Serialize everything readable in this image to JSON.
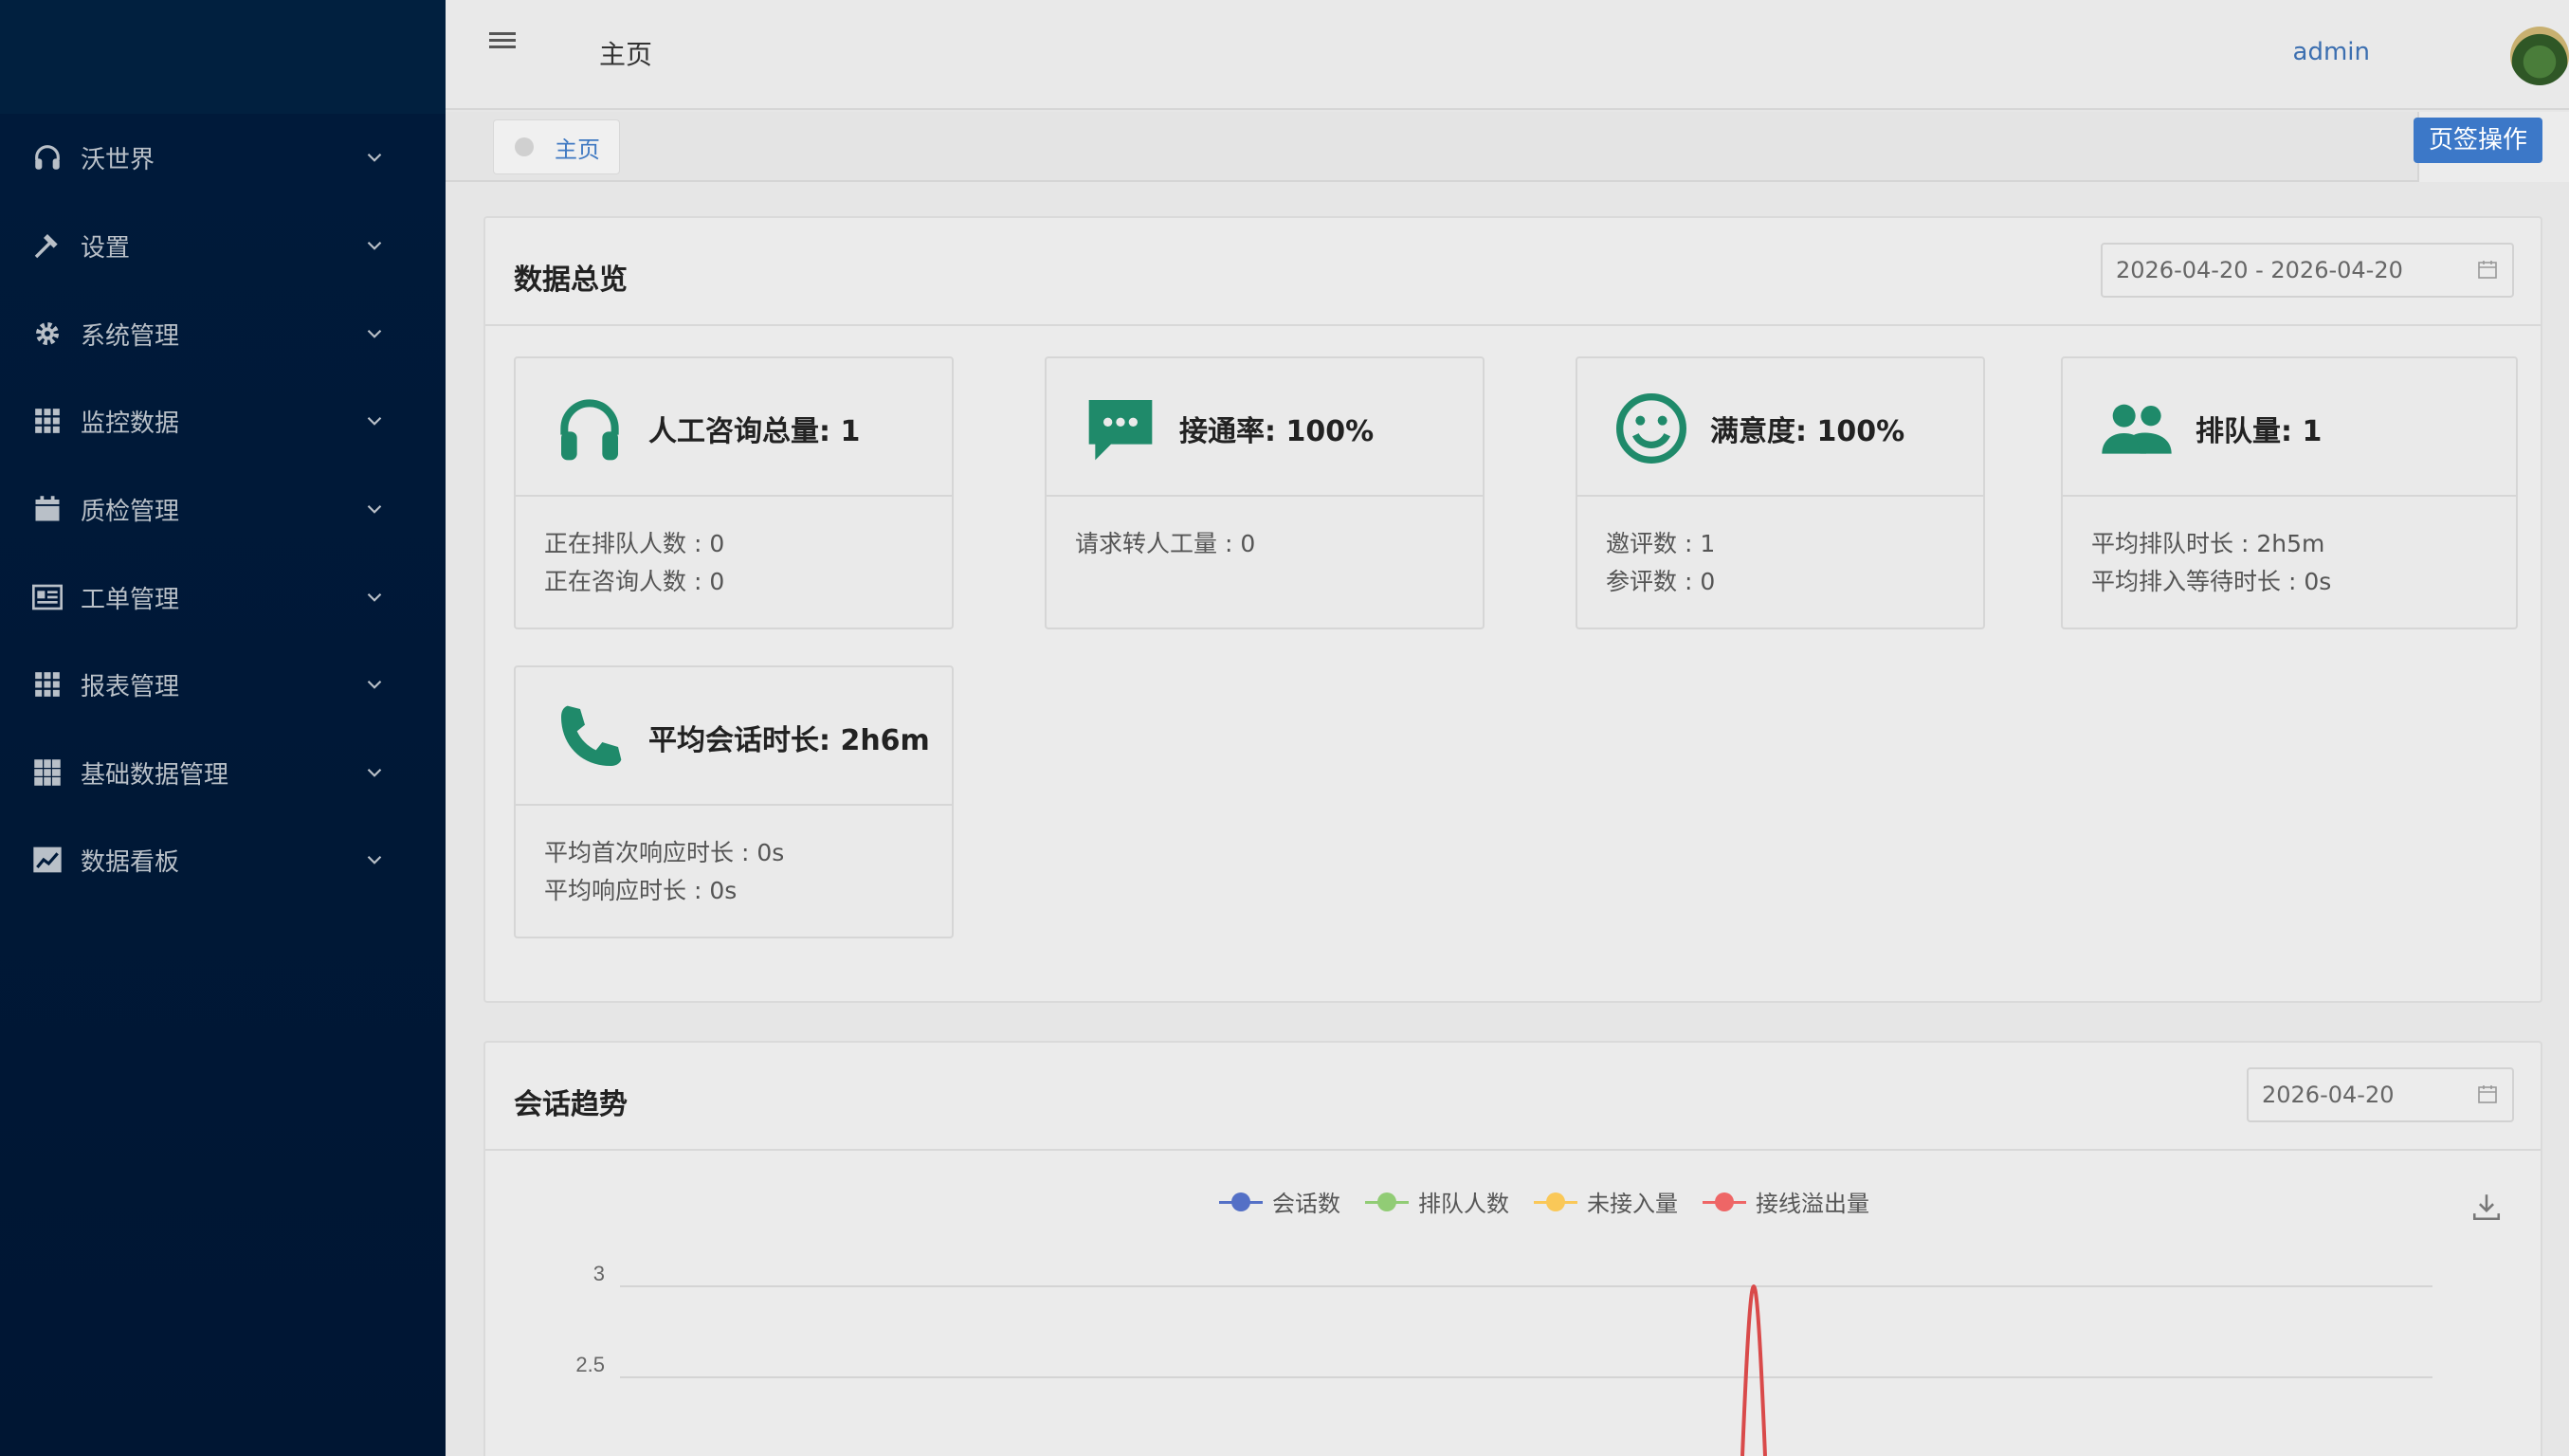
{
  "colors": {
    "sidebar_bg": "#001a3a",
    "accent": "#3c78c8",
    "icon_green": "#1f8a6a",
    "series_blue": "#5470c6",
    "series_green": "#91cc75",
    "series_yellow": "#fac858",
    "series_red": "#ee6666"
  },
  "sidebar": {
    "items": [
      {
        "label": "沃世界",
        "icon": "headset-icon"
      },
      {
        "label": "设置",
        "icon": "hammer-icon"
      },
      {
        "label": "系统管理",
        "icon": "gear-icon"
      },
      {
        "label": "监控数据",
        "icon": "grid-icon"
      },
      {
        "label": "质检管理",
        "icon": "calendar-icon"
      },
      {
        "label": "工单管理",
        "icon": "newspaper-icon"
      },
      {
        "label": "报表管理",
        "icon": "grid-icon"
      },
      {
        "label": "基础数据管理",
        "icon": "table-icon"
      },
      {
        "label": "数据看板",
        "icon": "line-chart-icon"
      }
    ]
  },
  "header": {
    "title": "主页",
    "user": "admin"
  },
  "tabs": {
    "active": "主页",
    "ops_label": "页签操作"
  },
  "overview": {
    "title": "数据总览",
    "date_range": "2026-04-20 - 2026-04-20",
    "cards": [
      {
        "icon": "headset-icon",
        "title": "人工咨询总量: 1",
        "lines": [
          "正在排队人数 : 0",
          "正在咨询人数 : 0"
        ]
      },
      {
        "icon": "chat-bubble-icon",
        "title": "接通率: 100%",
        "lines": [
          "请求转人工量 : 0"
        ]
      },
      {
        "icon": "smiley-icon",
        "title": "满意度: 100%",
        "lines": [
          "邀评数 : 1",
          "参评数 : 0"
        ]
      },
      {
        "icon": "users-icon",
        "title": "排队量: 1",
        "lines": [
          "平均排队时长 : 2h5m",
          "平均排入等待时长 : 0s"
        ]
      },
      {
        "icon": "phone-icon",
        "title": "平均会话时长: 2h6m",
        "lines": [
          "平均首次响应时长 : 0s",
          "平均响应时长 : 0s"
        ]
      }
    ]
  },
  "trend": {
    "title": "会话趋势",
    "date": "2026-04-20"
  },
  "chart_data": {
    "type": "line",
    "legend": [
      "会话数",
      "排队人数",
      "未接入量",
      "接线溢出量"
    ],
    "y_ticks": [
      "3",
      "2.5"
    ],
    "ylim": [
      0,
      3
    ],
    "series": [
      {
        "name": "会话数",
        "color": "#5470c6"
      },
      {
        "name": "排队人数",
        "color": "#91cc75"
      },
      {
        "name": "未接入量",
        "color": "#fac858"
      },
      {
        "name": "接线溢出量",
        "color": "#ee6666",
        "peak_value": 3
      }
    ],
    "grid": true,
    "legend_position": "top-center"
  }
}
